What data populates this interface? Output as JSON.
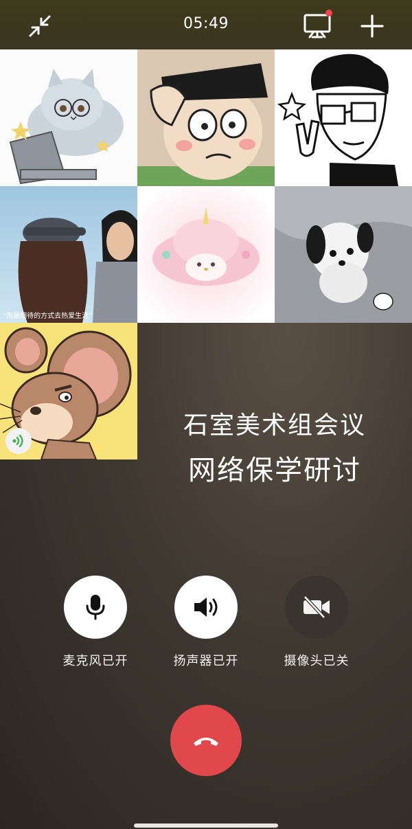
{
  "status": {
    "time": "05:49"
  },
  "toolbar": {
    "minimize_icon": "minimize-arrows-icon",
    "screen_share_icon": "screen-share-icon",
    "add_icon": "plus-icon",
    "badge_color": "#f2454a"
  },
  "participants": [
    {
      "avatar": "cat-with-glasses-laptop"
    },
    {
      "avatar": "cartoon-boy-saluting"
    },
    {
      "avatar": "sketch-man-peace-sign"
    },
    {
      "avatar": "couple-illustration",
      "caption": "“用最期待的方式去热爱生活”"
    },
    {
      "avatar": "pink-plush-toy"
    },
    {
      "avatar": "white-puppy"
    },
    {
      "avatar": "jerry-mouse",
      "speaking_icon": "sound-waves-icon"
    }
  ],
  "meeting": {
    "line1": "石室美术组会议",
    "line2": "网络保学研讨"
  },
  "controls": [
    {
      "label": "麦克风已开",
      "icon": "microphone-icon",
      "state": "on"
    },
    {
      "label": "扬声器已开",
      "icon": "speaker-icon",
      "state": "on"
    },
    {
      "label": "摄像头已关",
      "icon": "camera-off-icon",
      "state": "off"
    }
  ],
  "hangup": {
    "icon": "hangup-phone-icon",
    "color": "#e0484c"
  }
}
